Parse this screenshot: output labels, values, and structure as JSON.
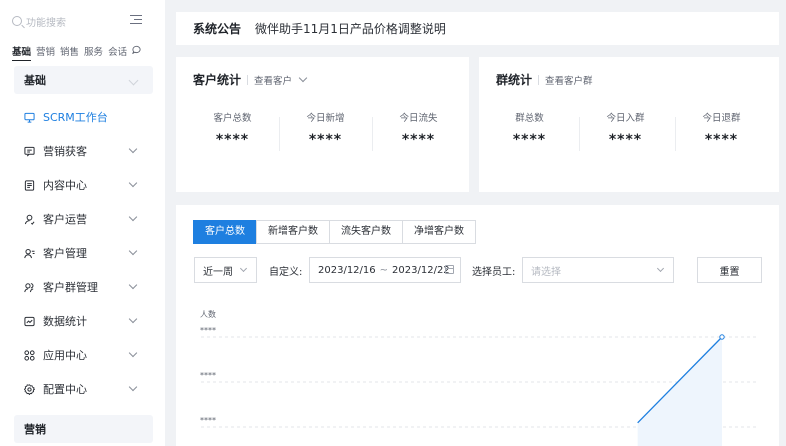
{
  "sidebar": {
    "search_placeholder": "功能搜索",
    "tabs": [
      "基础",
      "营销",
      "销售",
      "服务",
      "会话"
    ],
    "section_basic": "基础",
    "section_marketing": "营销",
    "items": [
      {
        "label": "SCRM工作台",
        "icon": "monitor-icon",
        "active": true
      },
      {
        "label": "营销获客",
        "icon": "message-icon"
      },
      {
        "label": "内容中心",
        "icon": "document-icon"
      },
      {
        "label": "客户运营",
        "icon": "user-icon"
      },
      {
        "label": "客户管理",
        "icon": "user-list-icon"
      },
      {
        "label": "客户群管理",
        "icon": "group-icon"
      },
      {
        "label": "数据统计",
        "icon": "chart-icon"
      },
      {
        "label": "应用中心",
        "icon": "apps-icon"
      },
      {
        "label": "配置中心",
        "icon": "settings-icon"
      }
    ]
  },
  "notice": {
    "title": "系统公告",
    "message": "微伴助手11月1日产品价格调整说明"
  },
  "customer_stats": {
    "title": "客户统计",
    "link": "查看客户",
    "stats": [
      {
        "label": "客户总数",
        "value": "****"
      },
      {
        "label": "今日新增",
        "value": "****"
      },
      {
        "label": "今日流失",
        "value": "****"
      }
    ]
  },
  "group_stats": {
    "title": "群统计",
    "link": "查看客户群",
    "stats": [
      {
        "label": "群总数",
        "value": "****"
      },
      {
        "label": "今日入群",
        "value": "****"
      },
      {
        "label": "今日退群",
        "value": "****"
      }
    ]
  },
  "trend": {
    "tabs": [
      "客户总数",
      "新增客户数",
      "流失客户数",
      "净增客户数"
    ],
    "active_tab": 0,
    "period": "近一周",
    "custom_label": "自定义:",
    "date_start": "2023/12/16",
    "date_sep": "~",
    "date_end": "2023/12/22",
    "staff_label": "选择员工:",
    "staff_placeholder": "请选择",
    "reset": "重置"
  },
  "chart_data": {
    "type": "line",
    "ylabel": "人数",
    "y_tick_labels": [
      "****",
      "****",
      "****"
    ],
    "grid": true,
    "series": [
      {
        "values": [
          null,
          null,
          null,
          null,
          null,
          0.35,
          1.0
        ]
      }
    ],
    "colors": {
      "line": "#1e7fe0",
      "area": "#eef5fd"
    }
  },
  "colors": {
    "accent": "#1e7fe0",
    "background": "#f0f2f5"
  }
}
